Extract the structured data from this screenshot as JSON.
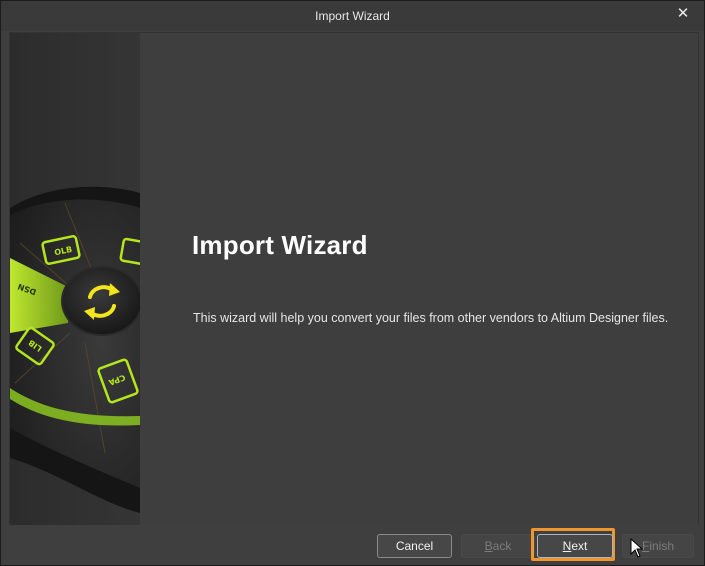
{
  "window": {
    "title": "Import Wizard",
    "close_glyph": "✕"
  },
  "main": {
    "heading": "Import Wizard",
    "description": "This wizard will help you convert your files from other vendors to Altium Designer files."
  },
  "side_art": {
    "icon_labels": [
      "OLB",
      "LIB",
      "CPA",
      "DSN"
    ],
    "center_icon": "refresh-icon",
    "accent_color": "#b5e61d"
  },
  "footer": {
    "cancel": "Cancel",
    "back_mnemonic": "B",
    "back_rest": "ack",
    "next_mnemonic": "N",
    "next_rest": "ext",
    "finish_mnemonic": "F",
    "finish_rest": "inish"
  },
  "colors": {
    "highlight": "#f0962f"
  }
}
